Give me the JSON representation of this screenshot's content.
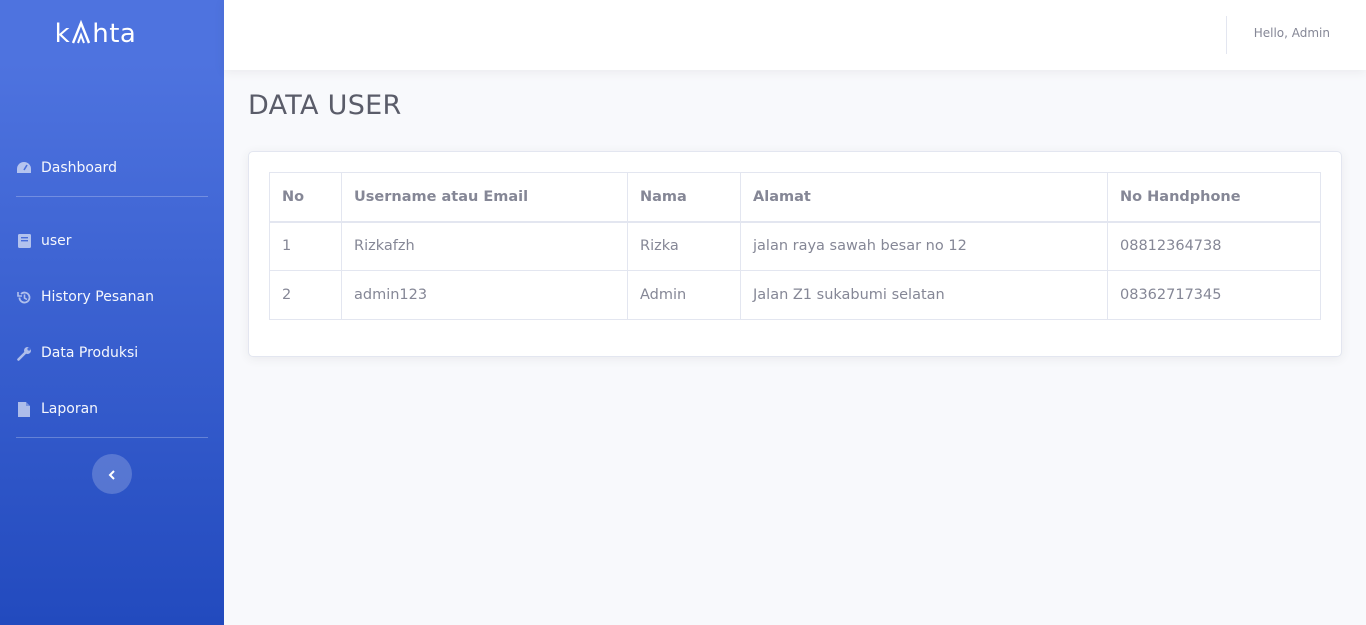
{
  "sidebar": {
    "brand": "kahta",
    "items": [
      {
        "label": "Dashboard",
        "icon": "tachometer-icon"
      },
      {
        "label": "user",
        "icon": "book-icon"
      },
      {
        "label": "History Pesanan",
        "icon": "history-icon"
      },
      {
        "label": "Data Produksi",
        "icon": "wrench-icon"
      },
      {
        "label": "Laporan",
        "icon": "file-icon"
      }
    ],
    "toggle_icon": "chevron-left-icon"
  },
  "topbar": {
    "greeting": "Hello, Admin"
  },
  "main": {
    "title": "DATA USER",
    "table": {
      "headers": [
        "No",
        "Username atau Email",
        "Nama",
        "Alamat",
        "No Handphone"
      ],
      "rows": [
        [
          "1",
          "Rizkafzh",
          "Rizka",
          "jalan raya sawah besar no 12",
          "08812364738"
        ],
        [
          "2",
          "admin123",
          "Admin",
          "Jalan Z1 sukabumi selatan",
          "08362717345"
        ]
      ]
    }
  },
  "colors": {
    "sidebar_start": "#4e73df",
    "sidebar_end": "#224abe",
    "background": "#f8f9fc",
    "text": "#858796"
  }
}
